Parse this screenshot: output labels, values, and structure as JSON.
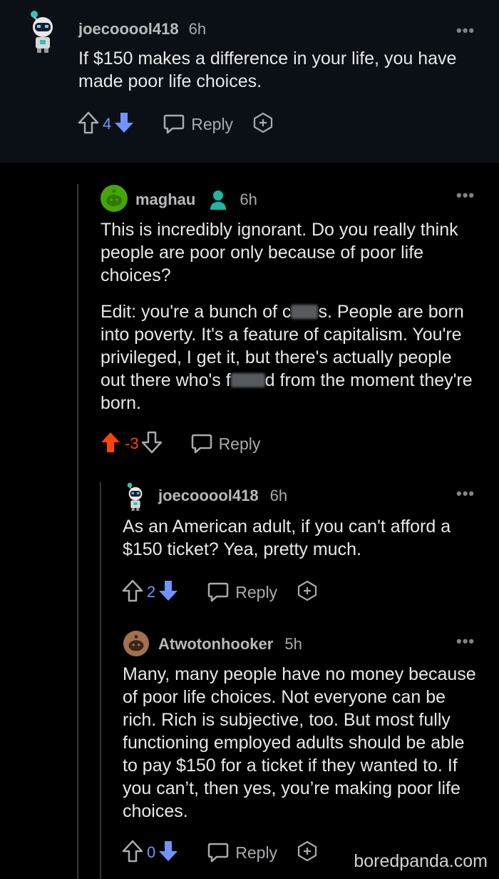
{
  "comments": [
    {
      "user": "joecooool418",
      "age": "6h",
      "paragraphs": [
        "If $150 makes a difference in your life, you have made poor life choices."
      ],
      "score": "4",
      "reply_label": "Reply",
      "more": "•••"
    },
    {
      "user": "maghau",
      "age": "6h",
      "paragraphs": [
        "This is incredibly ignorant. Do you really think people are poor only because of poor life choices?"
      ],
      "edit": {
        "p1_pre": "Edit: you're a bunch of c",
        "p1_post": "s. People are born into poverty. It's a feature of capitalism. You're privileged, I get it, but there's actually people out there who's f",
        "p1_end": "d from the moment they're born."
      },
      "score": "-3",
      "reply_label": "Reply",
      "more": "•••"
    },
    {
      "user": "joecooool418",
      "age": "6h",
      "paragraphs": [
        "As an American adult, if you can't afford a $150 ticket? Yea, pretty much."
      ],
      "score": "2",
      "reply_label": "Reply",
      "more": "•••"
    },
    {
      "user": "Atwotonhooker",
      "age": "5h",
      "paragraphs": [
        "Many, many people have no money because of poor life choices. Not everyone can be rich. Rich is subjective, too. But most fully functioning employed adults should be able to pay $150 for a ticket if they wanted to. If you can’t, then yes, you’re making poor life choices."
      ],
      "score": "0",
      "reply_label": "Reply",
      "more": "•••"
    }
  ],
  "watermark": "boredpanda.com",
  "colors": {
    "upvote_active": "#ff4500",
    "downvote_active": "#7193ff",
    "background": "#000000",
    "top_background": "#0b1016"
  }
}
